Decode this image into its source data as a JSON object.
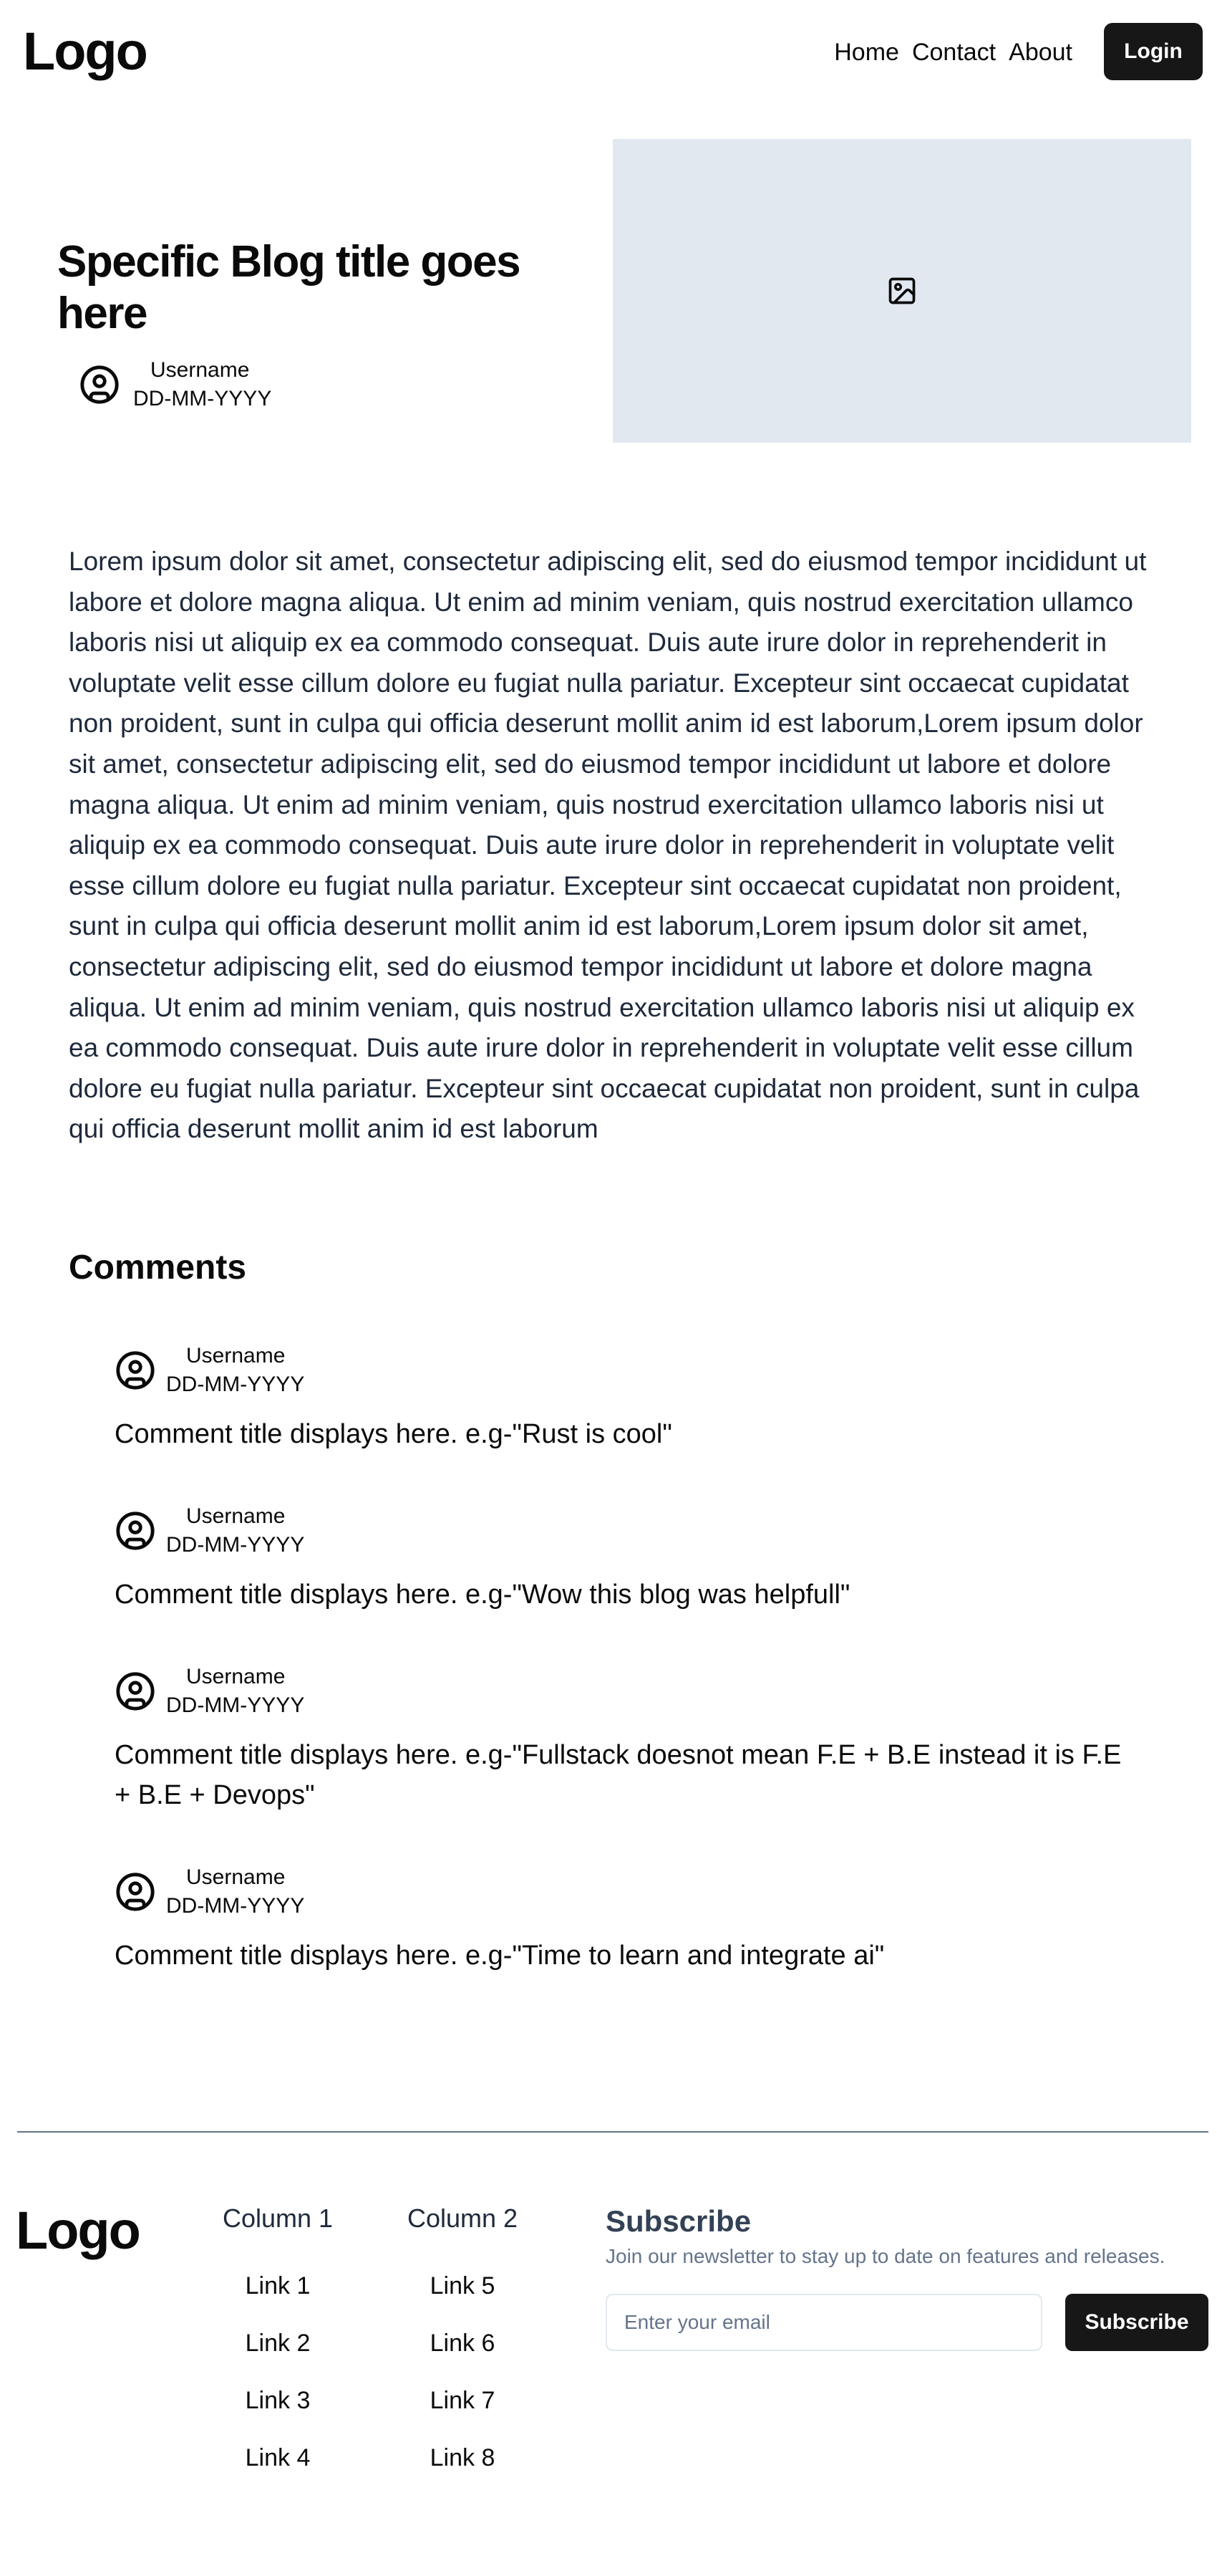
{
  "header": {
    "logo": "Logo",
    "nav": [
      "Home",
      "Contact",
      "About"
    ],
    "login_label": "Login"
  },
  "post": {
    "title": "Specific Blog title goes here",
    "author": "Username",
    "date": "DD-MM-YYYY",
    "image_icon": "image-icon",
    "body": "Lorem ipsum dolor sit amet, consectetur adipiscing elit, sed do eiusmod tempor incididunt ut labore et dolore magna aliqua. Ut enim ad minim veniam, quis nostrud exercitation ullamco laboris nisi ut aliquip ex ea commodo consequat. Duis aute irure dolor in reprehenderit in voluptate velit esse cillum dolore eu fugiat nulla pariatur. Excepteur sint occaecat cupidatat non proident, sunt in culpa qui officia deserunt mollit anim id est laborum,Lorem ipsum dolor sit amet, consectetur adipiscing elit, sed do eiusmod tempor incididunt ut labore et dolore magna aliqua. Ut enim ad minim veniam, quis nostrud exercitation ullamco laboris nisi ut aliquip ex ea commodo consequat. Duis aute irure dolor in reprehenderit in voluptate velit esse cillum dolore eu fugiat nulla pariatur. Excepteur sint occaecat cupidatat non proident, sunt in culpa qui officia deserunt mollit anim id est laborum,Lorem ipsum dolor sit amet, consectetur adipiscing elit, sed do eiusmod tempor incididunt ut labore et dolore magna aliqua. Ut enim ad minim veniam, quis nostrud exercitation ullamco laboris nisi ut aliquip ex ea commodo consequat. Duis aute irure dolor in reprehenderit in voluptate velit esse cillum dolore eu fugiat nulla pariatur. Excepteur sint occaecat cupidatat non proident, sunt in culpa qui officia deserunt mollit anim id est laborum"
  },
  "comments": {
    "title": "Comments",
    "items": [
      {
        "username": "Username",
        "date": "DD-MM-YYYY",
        "text": "Comment title displays here. e.g-\"Rust is cool\""
      },
      {
        "username": "Username",
        "date": "DD-MM-YYYY",
        "text": "Comment title displays here. e.g-\"Wow this blog was helpfull\""
      },
      {
        "username": "Username",
        "date": "DD-MM-YYYY",
        "text": "Comment title displays here. e.g-\"Fullstack doesnot mean F.E + B.E instead it is F.E + B.E + Devops\""
      },
      {
        "username": "Username",
        "date": "DD-MM-YYYY",
        "text": "Comment title displays here. e.g-\"Time to learn and integrate ai\""
      }
    ]
  },
  "footer": {
    "logo": "Logo",
    "columns": [
      {
        "title": "Column 1",
        "links": [
          "Link 1",
          "Link 2",
          "Link 3",
          "Link 4"
        ]
      },
      {
        "title": "Column 2",
        "links": [
          "Link 5",
          "Link 6",
          "Link 7",
          "Link 8"
        ]
      }
    ],
    "subscribe": {
      "title": "Subscribe",
      "description": "Join our newsletter to stay up to date on features and releases.",
      "placeholder": "Enter your email",
      "button_label": "Subscribe"
    }
  },
  "colors": {
    "button_bg": "#171717",
    "image_placeholder": "#e2e8f0",
    "body_text": "#1e293b",
    "divider": "#64748b"
  }
}
